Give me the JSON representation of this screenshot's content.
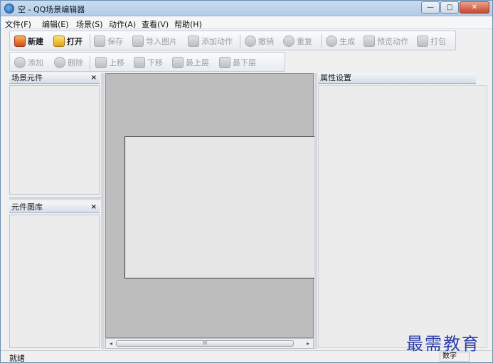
{
  "window": {
    "title": "空 - QQ场景编辑器",
    "minimize": "—",
    "maximize": "▢",
    "close": "✕"
  },
  "menu": [
    "文件(F)",
    "编辑(E)",
    "场景(S)",
    "动作(A)",
    "查看(V)",
    "帮助(H)"
  ],
  "toolbar1": {
    "new": "新建",
    "open": "打开",
    "save": "保存",
    "import_image": "导入图片",
    "add_action": "添加动作",
    "undo": "撤销",
    "redo": "重复",
    "generate": "生成",
    "preview_action": "预览动作",
    "pack": "打包"
  },
  "toolbar2": {
    "add": "添加",
    "delete": "删除",
    "move_up": "上移",
    "move_down": "下移",
    "top_layer": "最上层",
    "bottom_layer": "最下层"
  },
  "panels": {
    "scene_elements": "场景元件",
    "element_library": "元件图库",
    "properties": "属性设置",
    "close_glyph": "×"
  },
  "scrollbar": {
    "left_arrow": "◂",
    "right_arrow": "▸",
    "grip": "III"
  },
  "status": {
    "left": "就绪",
    "right": "数字"
  },
  "watermark": "最需教育"
}
